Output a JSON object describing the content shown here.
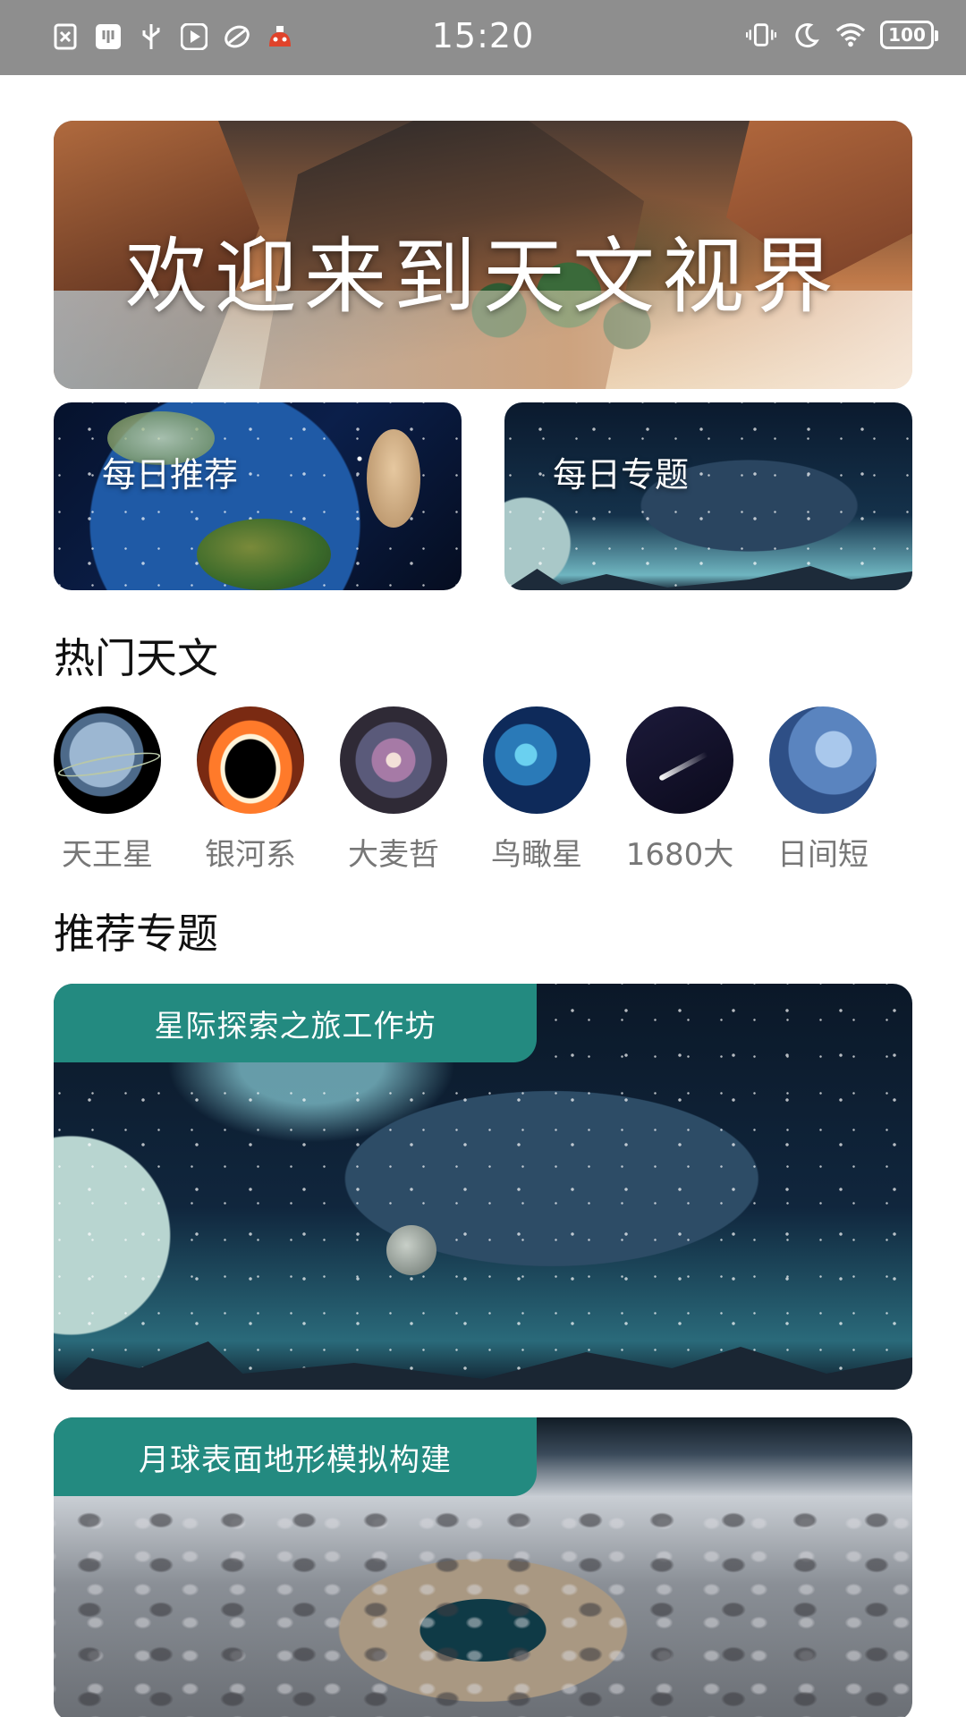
{
  "status_bar": {
    "time": "15:20",
    "battery": "100",
    "left_icons": [
      "sim-off-icon",
      "usb-debug-icon",
      "usb-icon",
      "media-icon",
      "app-icon",
      "mascot-icon"
    ],
    "right_icons": [
      "vibrate-icon",
      "moon-icon",
      "wifi-icon",
      "battery-icon"
    ]
  },
  "banner": {
    "title": "欢迎来到天文视界"
  },
  "cards": [
    {
      "label": "每日推荐"
    },
    {
      "label": "每日专题"
    }
  ],
  "hot": {
    "title": "热门天文",
    "items": [
      {
        "label": "天王星"
      },
      {
        "label": "银河系"
      },
      {
        "label": "大麦哲"
      },
      {
        "label": "鸟瞰星"
      },
      {
        "label": "1680大"
      },
      {
        "label": "日间短"
      }
    ]
  },
  "recommend": {
    "title": "推荐专题",
    "topics": [
      {
        "tag": "星际探索之旅工作坊"
      },
      {
        "tag": "月球表面地形模拟构建"
      }
    ]
  },
  "colors": {
    "status_bar": "#8e8e8e",
    "tag_green": "#238a80",
    "label_gray": "#777777"
  }
}
